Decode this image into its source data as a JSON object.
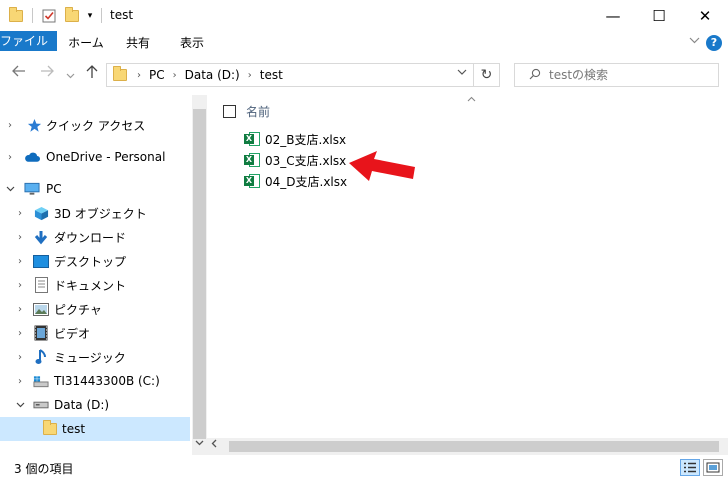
{
  "window": {
    "title": "test",
    "minimize": "—",
    "maximize": "☐",
    "close": "✕"
  },
  "ribbon": {
    "tabs": [
      "ファイル",
      "ホーム",
      "共有",
      "表示"
    ],
    "collapse_icon": "chevron-down",
    "help": "?"
  },
  "nav": {
    "address": [
      "PC",
      "Data (D:)",
      "test"
    ],
    "search_placeholder": "testの検索"
  },
  "sidebar": {
    "items": [
      {
        "label": "クイック アクセス",
        "icon": "star-icon",
        "selected": false
      },
      {
        "label": "OneDrive - Personal",
        "icon": "cloud-icon",
        "selected": false
      },
      {
        "label": "PC",
        "icon": "pc-icon",
        "selected": false
      },
      {
        "label": "3D オブジェクト",
        "icon": "cube-icon",
        "selected": false
      },
      {
        "label": "ダウンロード",
        "icon": "download-icon",
        "selected": false
      },
      {
        "label": "デスクトップ",
        "icon": "desktop-icon",
        "selected": false
      },
      {
        "label": "ドキュメント",
        "icon": "document-icon",
        "selected": false
      },
      {
        "label": "ピクチャ",
        "icon": "picture-icon",
        "selected": false
      },
      {
        "label": "ビデオ",
        "icon": "video-icon",
        "selected": false
      },
      {
        "label": "ミュージック",
        "icon": "music-icon",
        "selected": false
      },
      {
        "label": "TI31443300B (C:)",
        "icon": "windows-drive-icon",
        "selected": false
      },
      {
        "label": "Data (D:)",
        "icon": "drive-icon",
        "selected": false
      },
      {
        "label": "test",
        "icon": "folder-icon",
        "selected": true
      }
    ]
  },
  "content": {
    "column_header": "名前",
    "files": [
      {
        "name": "02_B支店.xlsx",
        "icon": "excel-file-icon"
      },
      {
        "name": "03_C支店.xlsx",
        "icon": "excel-file-icon"
      },
      {
        "name": "04_D支店.xlsx",
        "icon": "excel-file-icon"
      }
    ],
    "annotation_color": "#e8141b"
  },
  "status": {
    "count_text": "3 個の項目"
  },
  "colors": {
    "accent": "#1979ca",
    "selection": "#cce8ff",
    "excel_green": "#107c41"
  }
}
